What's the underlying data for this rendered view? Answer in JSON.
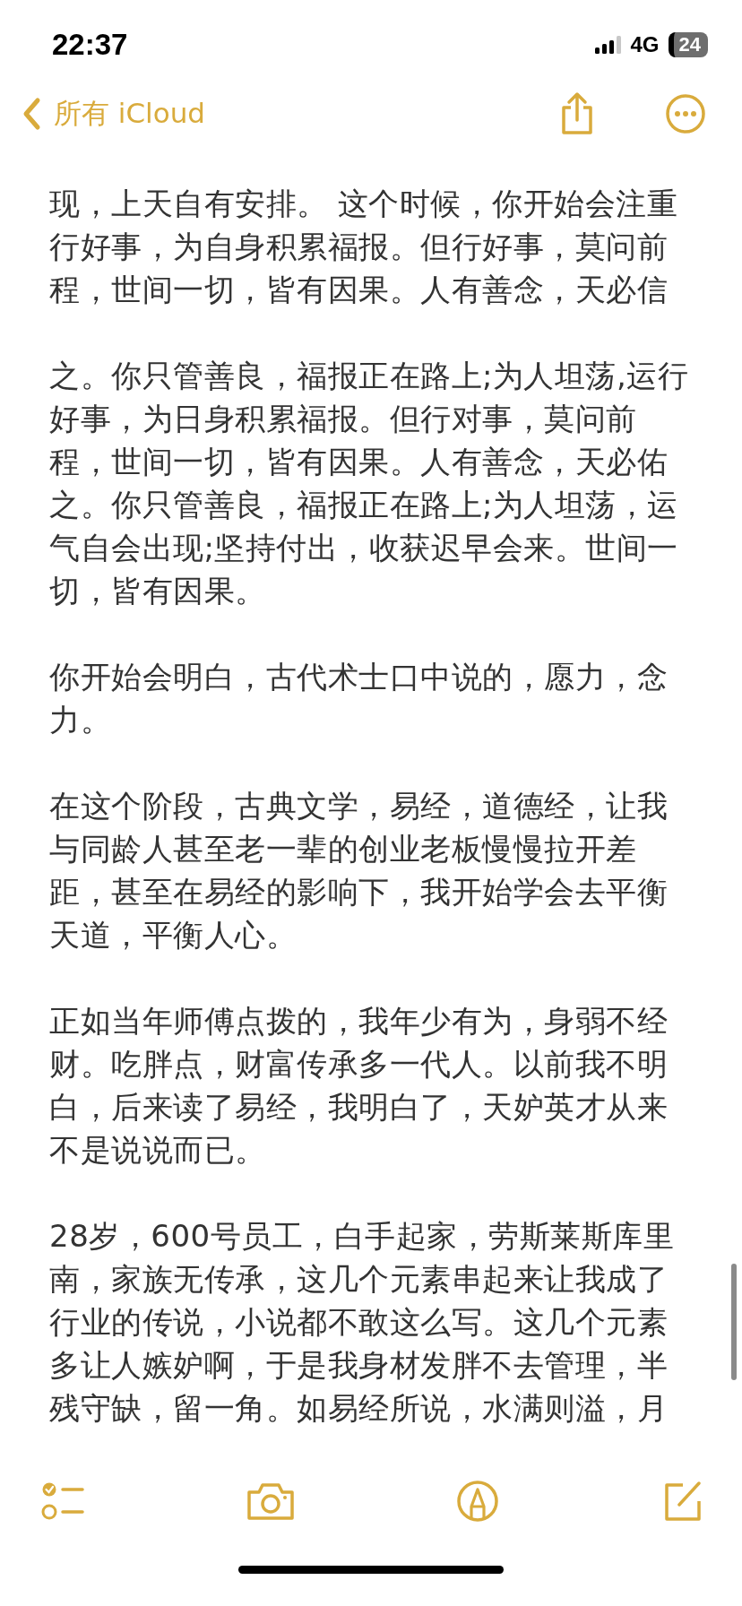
{
  "status_bar": {
    "time": "22:37",
    "network": "4G",
    "battery": "24"
  },
  "nav": {
    "back_label": "所有 iCloud"
  },
  "note": {
    "paragraphs": [
      {
        "lines": [
          "现，上天自有安排。 这个时候，你开始会注重",
          "行好事，为自身积累福报。但行好事，莫问前",
          "程，世间一切，皆有因果。人有善念，天必信"
        ]
      },
      {
        "lines": [
          "之。你只管善良，福报正在路上;为人坦荡,运行",
          "好事，为日身积累福报。但行对事，莫问前",
          "程，世间一切，皆有因果。人有善念，天必佑",
          "之。你只管善良，福报正在路上;为人坦荡，运",
          "气自会出现;坚持付出，收获迟早会来。世间一",
          "切，皆有因果。"
        ]
      },
      {
        "lines": [
          "你开始会明白，古代术士口中说的，愿力，念",
          "力。"
        ]
      },
      {
        "lines": [
          "在这个阶段，古典文学，易经，道德经，让我",
          "与同龄人甚至老一辈的创业老板慢慢拉开差",
          "距，甚至在易经的影响下，我开始学会去平衡",
          "天道，平衡人心。"
        ]
      },
      {
        "lines": [
          "正如当年师傅点拨的，我年少有为，身弱不经",
          "财。吃胖点，财富传承多一代人。以前我不明",
          "白，后来读了易经，我明白了，天妒英才从来",
          "不是说说而已。"
        ]
      },
      {
        "lines": [
          "28岁，600号员工，白手起家，劳斯莱斯库里",
          "南，家族无传承，这几个元素串起来让我成了",
          "行业的传说，小说都不敢这么写。这几个元素",
          "多让人嫉妒啊，于是我身材发胖不去管理，半",
          "残守缺，留一角。如易经所说，水满则溢，月"
        ]
      }
    ]
  }
}
